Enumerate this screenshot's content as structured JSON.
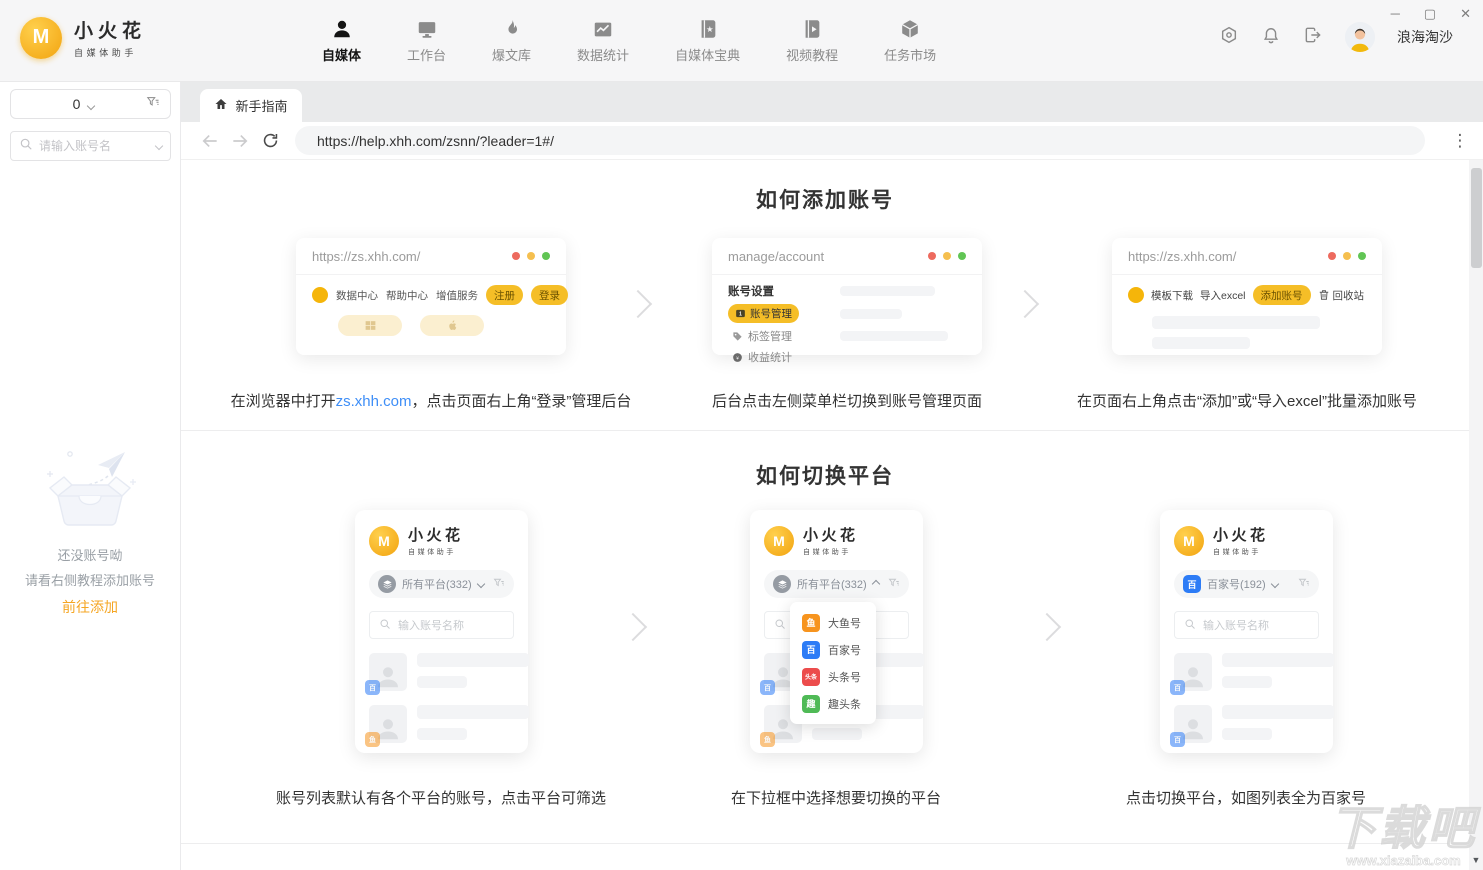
{
  "window_controls": {
    "minimize": "─",
    "maximize": "▢",
    "close": "✕"
  },
  "app": {
    "name": "小火花",
    "subtitle": "自媒体助手",
    "logo_letter": "M",
    "nav": [
      {
        "label": "自媒体"
      },
      {
        "label": "工作台"
      },
      {
        "label": "爆文库"
      },
      {
        "label": "数据统计"
      },
      {
        "label": "自媒体宝典"
      },
      {
        "label": "视频教程"
      },
      {
        "label": "任务市场"
      }
    ],
    "user": {
      "name": "浪海淘沙"
    }
  },
  "sidebar": {
    "count": "0",
    "search_placeholder": "请输入账号名",
    "empty": {
      "line1": "还没账号呦",
      "line2": "请看右侧教程添加账号",
      "action": "前往添加"
    }
  },
  "browser": {
    "tab_label": "新手指南",
    "url": "https://help.xhh.com/zsnn/?leader=1#/"
  },
  "section_add": {
    "title": "如何添加账号",
    "card1": {
      "url": "https://zs.xhh.com/",
      "nav": [
        "数据中心",
        "帮助中心",
        "增值服务"
      ],
      "register": "注册",
      "login": "登录",
      "caption_pre": "在浏览器中打开",
      "caption_link": "zs.xhh.com",
      "caption_post": "，点击页面右上角“登录”管理后台"
    },
    "card2": {
      "url": "manage/account",
      "heading": "账号设置",
      "item_account": "账号管理",
      "item_tag": "标签管理",
      "item_revenue": "收益统计",
      "caption": "后台点击左侧菜单栏切换到账号管理页面"
    },
    "card3": {
      "url": "https://zs.xhh.com/",
      "link_template": "模板下载",
      "link_import": "导入excel",
      "add_button": "添加账号",
      "recycle": "回收站",
      "caption": "在页面右上角点击“添加”或“导入excel”批量添加账号"
    }
  },
  "section_switch": {
    "title": "如何切换平台",
    "search_placeholder": "输入账号名称",
    "mock1": {
      "selector": "所有平台(332)",
      "caption": "账号列表默认有各个平台的账号，点击平台可筛选"
    },
    "mock2": {
      "selector": "所有平台(332)",
      "caption": "在下拉框中选择想要切换的平台"
    },
    "mock3": {
      "selector": "百家号(192)",
      "caption": "点击切换平台，如图列表全为百家号"
    },
    "platforms": [
      {
        "name": "大鱼号",
        "color": "#F7941E",
        "glyph": "鱼"
      },
      {
        "name": "百家号",
        "color": "#2D7CF6",
        "glyph": "百"
      },
      {
        "name": "头条号",
        "color": "#EC4C4C",
        "glyph": "头条"
      },
      {
        "name": "趣头条",
        "color": "#4FBA56",
        "glyph": "趣"
      }
    ]
  },
  "watermark": {
    "title": "下载吧",
    "url": "www.xiazaiba.com"
  },
  "colors": {
    "accent": "#F5A623",
    "pill_yellow": "#F5BE27",
    "link_blue": "#3E8EF7",
    "traffic_red": "#ED6A5E",
    "traffic_yellow": "#F5BF4F",
    "traffic_green": "#61C554"
  }
}
